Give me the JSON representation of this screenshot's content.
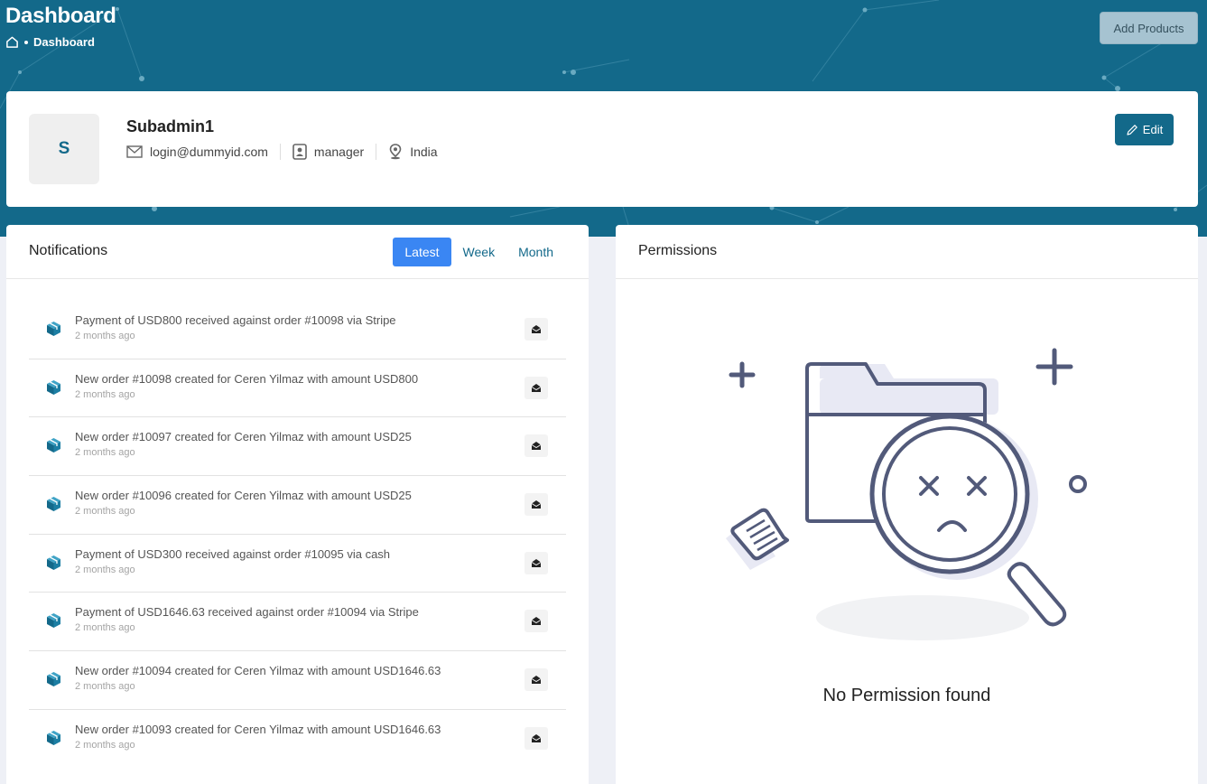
{
  "header": {
    "title": "Dashboard",
    "breadcrumb": "Dashboard",
    "add_button": "Add Products"
  },
  "profile": {
    "avatar_letter": "S",
    "name": "Subadmin1",
    "email": "login@dummyid.com",
    "role": "manager",
    "location": "India",
    "edit_label": "Edit"
  },
  "notifications": {
    "title": "Notifications",
    "tabs": [
      "Latest",
      "Week",
      "Month"
    ],
    "active_tab": "Latest",
    "items": [
      {
        "text": "Payment of USD800 received against order #10098 via Stripe",
        "time": "2 months ago"
      },
      {
        "text": "New order #10098 created for Ceren Yilmaz with amount USD800",
        "time": "2 months ago"
      },
      {
        "text": "New order #10097 created for Ceren Yilmaz with amount USD25",
        "time": "2 months ago"
      },
      {
        "text": "New order #10096 created for Ceren Yilmaz with amount USD25",
        "time": "2 months ago"
      },
      {
        "text": "Payment of USD300 received against order #10095 via cash",
        "time": "2 months ago"
      },
      {
        "text": "Payment of USD1646.63 received against order #10094 via Stripe",
        "time": "2 months ago"
      },
      {
        "text": "New order #10094 created for Ceren Yilmaz with amount USD1646.63",
        "time": "2 months ago"
      },
      {
        "text": "New order #10093 created for Ceren Yilmaz with amount USD1646.63",
        "time": "2 months ago"
      }
    ]
  },
  "permissions": {
    "title": "Permissions",
    "empty_text": "No Permission found"
  },
  "colors": {
    "brand": "#13698a",
    "tab_active": "#3a86f3",
    "illustration": "#525a7a"
  },
  "icons": {
    "home": "home-icon",
    "email": "envelope-icon",
    "role": "contact-card-icon",
    "location": "location-pin-icon",
    "edit": "pencil-icon",
    "notification": "package-cube-icon",
    "mark_read": "open-envelope-icon"
  }
}
